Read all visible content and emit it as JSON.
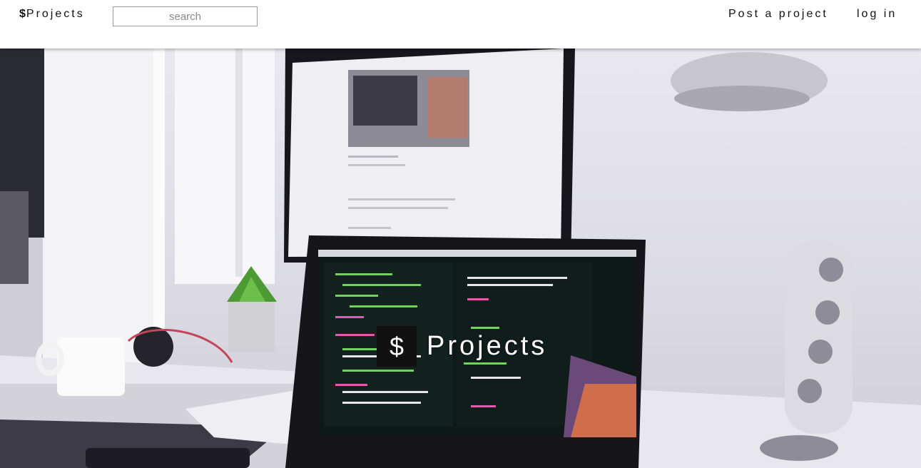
{
  "header": {
    "brand_symbol": "$",
    "brand_text": "Projects",
    "search_placeholder": "search",
    "nav": {
      "post_project": "Post a project",
      "login": "log in"
    }
  },
  "hero": {
    "symbol": "$",
    "title": "Projects",
    "background_description_icon": "desk-workspace-image"
  },
  "colors": {
    "title_box": "#111111",
    "title_text": "#ffffff",
    "header_bg": "#ffffff"
  }
}
